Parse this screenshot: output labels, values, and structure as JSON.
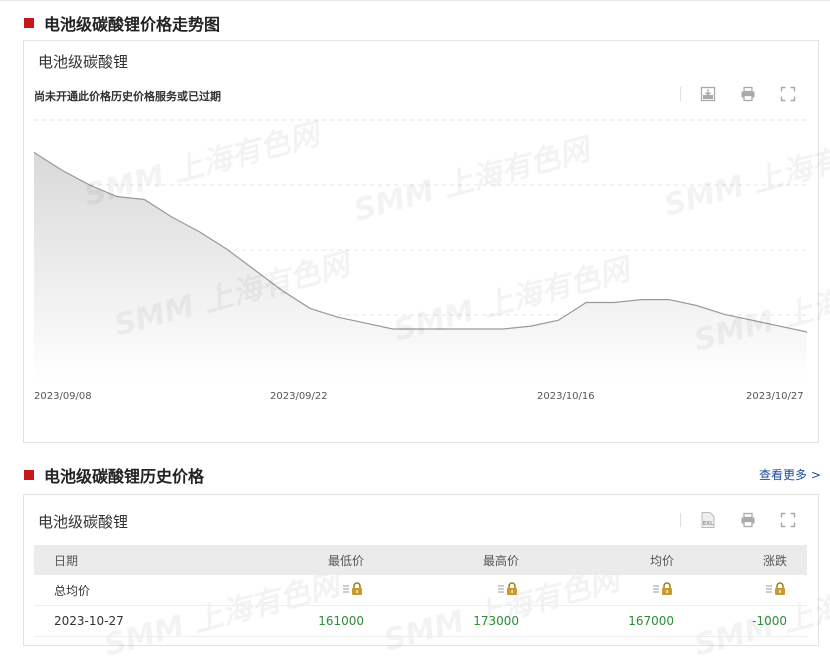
{
  "section1": {
    "title": "电池级碳酸锂价格走势图"
  },
  "chart_panel": {
    "title": "电池级碳酸锂",
    "notice": "尚未开通此价格历史价格服务或已过期",
    "tools": [
      "download-icon",
      "print-icon",
      "fullscreen-icon"
    ]
  },
  "watermark_text": "SMM 上海有色网",
  "chart_data": {
    "type": "area",
    "title": "",
    "x": [
      "2023/09/08",
      "2023/09/11",
      "2023/09/12",
      "2023/09/13",
      "2023/09/14",
      "2023/09/15",
      "2023/09/18",
      "2023/09/19",
      "2023/09/20",
      "2023/09/21",
      "2023/09/22",
      "2023/09/25",
      "2023/09/26",
      "2023/09/27",
      "2023/10/09",
      "2023/10/10",
      "2023/10/11",
      "2023/10/12",
      "2023/10/13",
      "2023/10/16",
      "2023/10/17",
      "2023/10/18",
      "2023/10/19",
      "2023/10/20",
      "2023/10/23",
      "2023/10/24",
      "2023/10/25",
      "2023/10/26",
      "2023/10/27"
    ],
    "values": [
      186000,
      183000,
      180500,
      178500,
      178000,
      175000,
      172500,
      169500,
      166000,
      162500,
      159500,
      158000,
      157000,
      156000,
      156000,
      156000,
      156000,
      156000,
      156500,
      157500,
      160500,
      160500,
      161000,
      161000,
      160000,
      158500,
      157500,
      156500,
      155500
    ],
    "xticks": [
      "2023/09/08",
      "2023/09/22",
      "2023/10/16",
      "2023/10/27"
    ],
    "ylim": [
      147000,
      191500
    ],
    "grid": true,
    "colors": {
      "line": "#999999",
      "fill_top": "#d9d9d9",
      "fill_bottom": "#ffffff"
    }
  },
  "section2": {
    "title": "电池级碳酸锂历史价格",
    "more_link": "查看更多 >"
  },
  "table_panel": {
    "title": "电池级碳酸锂",
    "tools": [
      "excel-icon",
      "print-icon",
      "fullscreen-icon"
    ],
    "excel_label": "EXL",
    "columns": [
      "日期",
      "最低价",
      "最高价",
      "均价",
      "涨跌"
    ],
    "rows": [
      {
        "date": "总均价",
        "locked": true
      },
      {
        "date": "2023-10-27",
        "low": "161000",
        "high": "173000",
        "avg": "167000",
        "change": "-1000"
      }
    ]
  },
  "colors": {
    "accent": "#c8161d",
    "link": "#1a4c9c",
    "positive": "#2e8b3a",
    "lock": "#c89b2a"
  }
}
